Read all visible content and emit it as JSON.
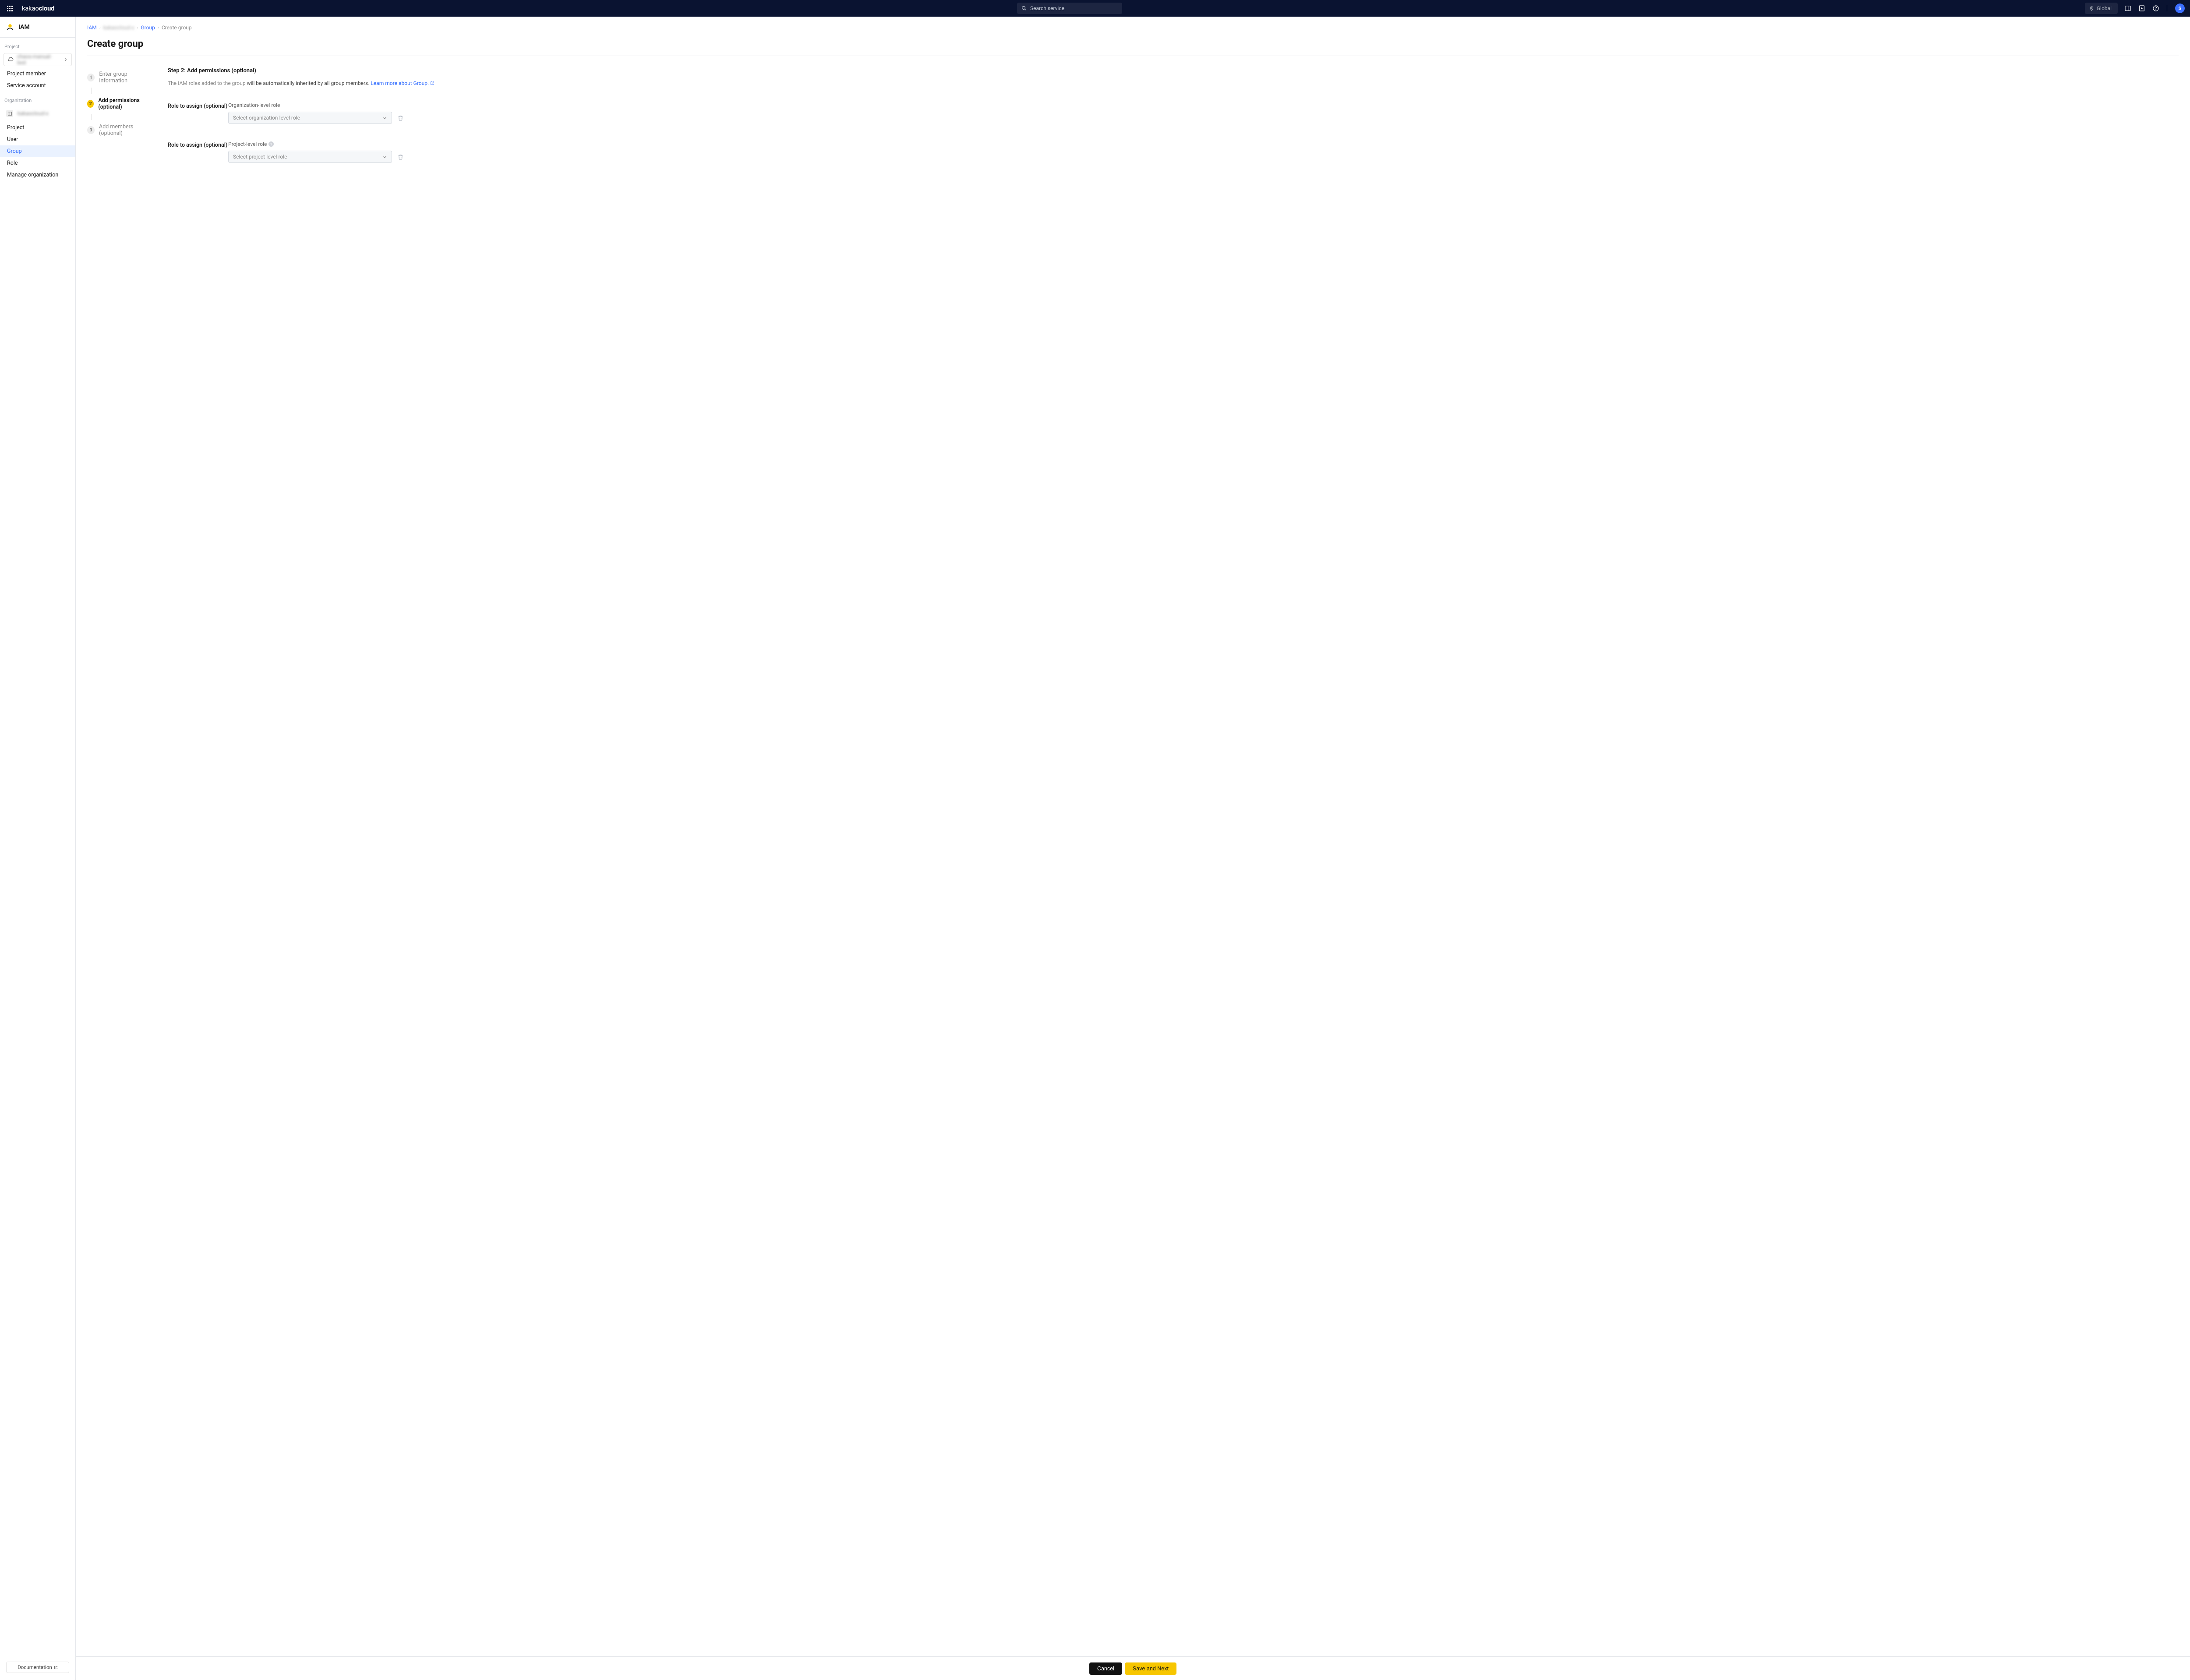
{
  "topbar": {
    "logo_text_normal": "kakao",
    "logo_text_bold": "cloud",
    "search_placeholder": "Search service",
    "global_label": "Global",
    "avatar_initial": "S"
  },
  "sidebar": {
    "service_name": "IAM",
    "project_label": "Project",
    "project_selected_blur": "chaos-manual-test",
    "nav_project_items": [
      "Project member",
      "Service account"
    ],
    "org_label": "Organization",
    "org_selected_blur": "kakaocloud-x",
    "nav_org_items": [
      "Project",
      "User",
      "Group",
      "Role",
      "Manage organization"
    ],
    "active_item": "Group",
    "documentation_label": "Documentation"
  },
  "breadcrumbs": {
    "items": [
      "IAM",
      "kakaocloud-x",
      "Group",
      "Create group"
    ]
  },
  "page": {
    "title": "Create group"
  },
  "steps": [
    {
      "num": "1",
      "label": "Enter group information"
    },
    {
      "num": "2",
      "label": "Add permissions (optional)"
    },
    {
      "num": "3",
      "label": "Add members (optional)"
    }
  ],
  "panel": {
    "title": "Step 2: Add permissions (optional)",
    "desc_pre": "The IAM roles added to the group ",
    "desc_strong": "will be automatically inherited by all group members",
    "desc_dot": ". ",
    "desc_link": "Learn more about Group.",
    "roles": [
      {
        "label": "Role to assign (optional)",
        "sub": "Organization-level role",
        "placeholder": "Select organization-level role",
        "info": false
      },
      {
        "label": "Role to assign (optional)",
        "sub": "Project-level role",
        "placeholder": "Select project-level role",
        "info": true
      }
    ]
  },
  "footer": {
    "cancel": "Cancel",
    "next": "Save and Next"
  }
}
